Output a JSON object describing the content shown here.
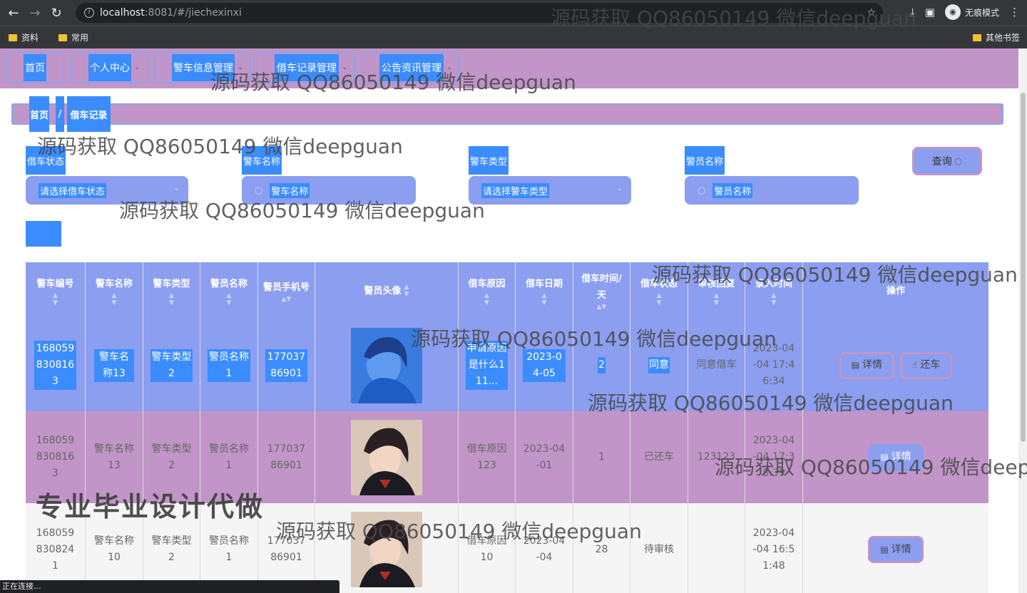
{
  "browser": {
    "url_host": "localhost",
    "url_path": ":8081/#/jiechexinxi",
    "incognito_label": "无痕模式",
    "bookmarks": [
      "资料",
      "常用"
    ],
    "other_bookmarks": "其他书签",
    "status_text": "正在连接..."
  },
  "nav": {
    "items": [
      "首页",
      "个人中心",
      "警车信息管理",
      "借车记录管理",
      "公告资讯管理"
    ]
  },
  "breadcrumb": {
    "home": "首页",
    "sep": "/",
    "current": "借车记录"
  },
  "filters": [
    {
      "label": "借车状态",
      "placeholder": "请选择借车状态",
      "kind": "select"
    },
    {
      "label": "警车名称",
      "placeholder": "警车名称",
      "kind": "input"
    },
    {
      "label": "警车类型",
      "placeholder": "请选择警车类型",
      "kind": "select"
    },
    {
      "label": "警员名称",
      "placeholder": "警员名称",
      "kind": "input"
    }
  ],
  "query_button": "查询",
  "table": {
    "headers": [
      "警车编号",
      "警车名称",
      "警车类型",
      "警员名称",
      "警员手机号",
      "警员头像",
      "借车原因",
      "借车日期",
      "借车时间/天",
      "借车状态",
      "审核回复",
      "录入时间",
      "操作"
    ],
    "rows": [
      {
        "code": "1680598308163",
        "name": "警车名称13",
        "type": "警车类型2",
        "officer": "警员名称1",
        "phone": "17703786901",
        "reason": "申请原因是什么111...",
        "date": "2023-04-05",
        "days": "2",
        "status": "同意",
        "reply": "同意借车",
        "created": "2023-04-04 17:46:34",
        "actions": [
          "详情",
          "还车"
        ]
      },
      {
        "code": "1680598308163",
        "name": "警车名称13",
        "type": "警车类型2",
        "officer": "警员名称1",
        "phone": "17703786901",
        "reason": "借车原因123",
        "date": "2023-04-01",
        "days": "1",
        "status": "已还车",
        "reply": "123123",
        "created": "2023-04-04 17:38:39",
        "actions": [
          "详情"
        ]
      },
      {
        "code": "1680598308241",
        "name": "警车名称10",
        "type": "警车类型2",
        "officer": "警员名称1",
        "phone": "17703786901",
        "reason": "借车原因10",
        "date": "2023-04-04",
        "days": "28",
        "status": "待审核",
        "reply": "",
        "created": "2023-04-04 16:51:48",
        "actions": [
          "详情"
        ]
      }
    ]
  },
  "watermarks": {
    "text": "源码获取 QQ86050149 微信deepguan",
    "big": "专业毕业设计代做"
  }
}
